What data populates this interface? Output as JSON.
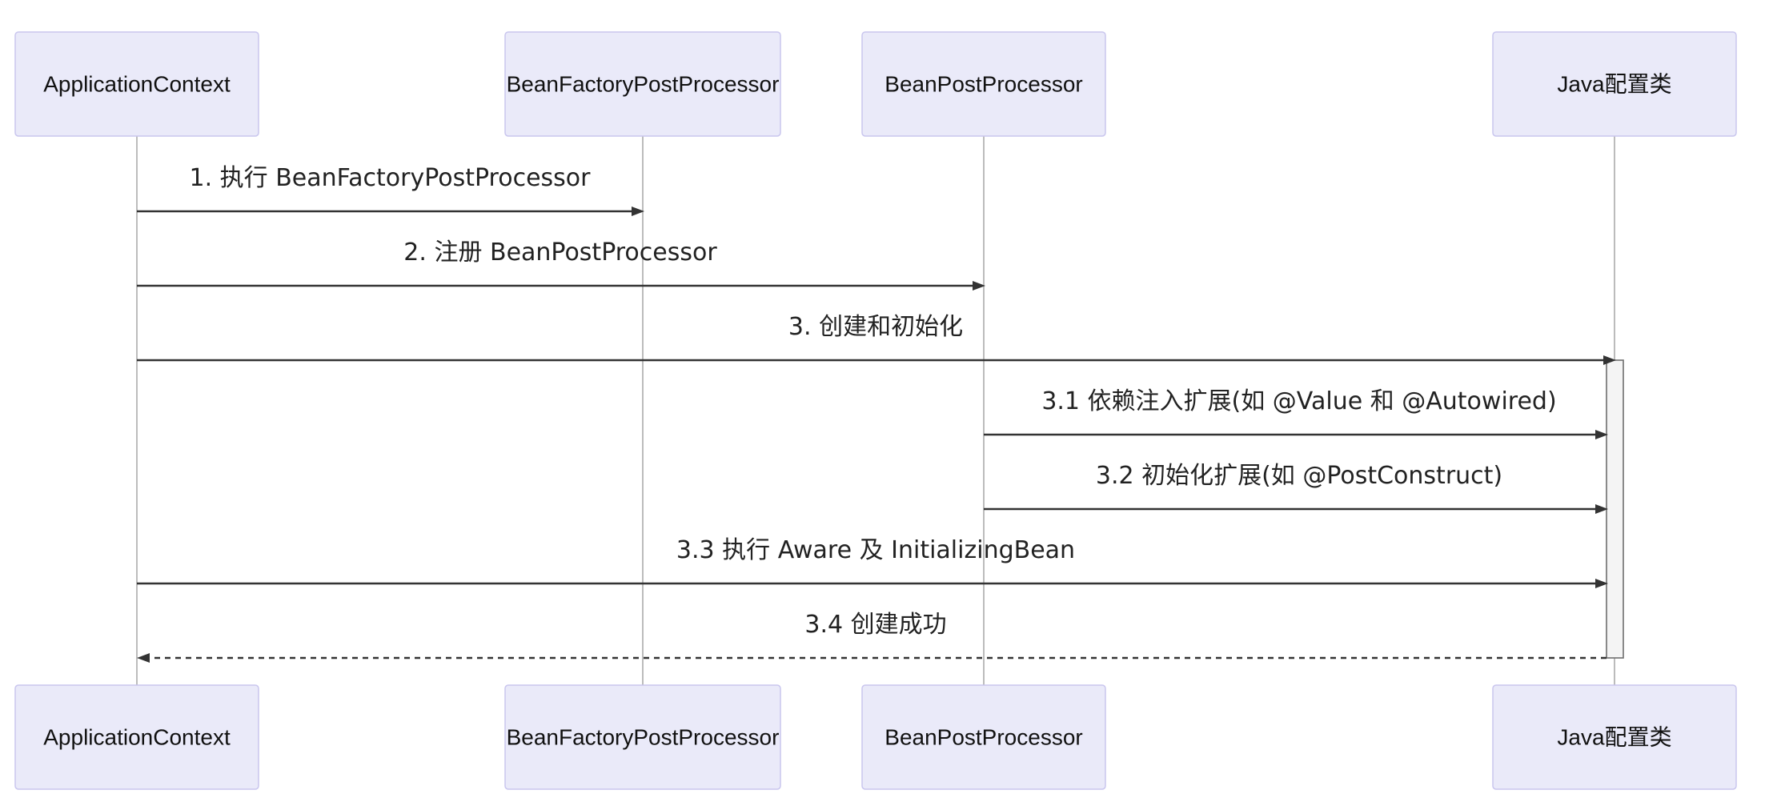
{
  "diagram": {
    "type": "sequence",
    "participants": [
      {
        "id": "ctx",
        "label": "ApplicationContext"
      },
      {
        "id": "bfpp",
        "label": "BeanFactoryPostProcessor"
      },
      {
        "id": "bpp",
        "label": "BeanPostProcessor"
      },
      {
        "id": "cfg",
        "label": "Java配置类"
      }
    ],
    "messages": [
      {
        "from": "ctx",
        "to": "bfpp",
        "label": "1. 执行 BeanFactoryPostProcessor",
        "style": "solid"
      },
      {
        "from": "ctx",
        "to": "bpp",
        "label": "2. 注册 BeanPostProcessor",
        "style": "solid"
      },
      {
        "from": "ctx",
        "to": "cfg",
        "label": "3. 创建和初始化",
        "style": "solid"
      },
      {
        "from": "bpp",
        "to": "cfg",
        "label": "3.1 依赖注入扩展(如 @Value 和 @Autowired)",
        "style": "solid"
      },
      {
        "from": "bpp",
        "to": "cfg",
        "label": "3.2 初始化扩展(如 @PostConstruct)",
        "style": "solid"
      },
      {
        "from": "ctx",
        "to": "cfg",
        "label": "3.3 执行 Aware 及 InitializingBean",
        "style": "solid"
      },
      {
        "from": "cfg",
        "to": "ctx",
        "label": "3.4 创建成功",
        "style": "dashed"
      }
    ],
    "colors": {
      "actor_fill": "#eaeaf9",
      "actor_stroke": "#c9c6ee",
      "line": "#333333",
      "lifeline": "#b5b5b5",
      "activation_fill": "#f4f4f4"
    }
  }
}
